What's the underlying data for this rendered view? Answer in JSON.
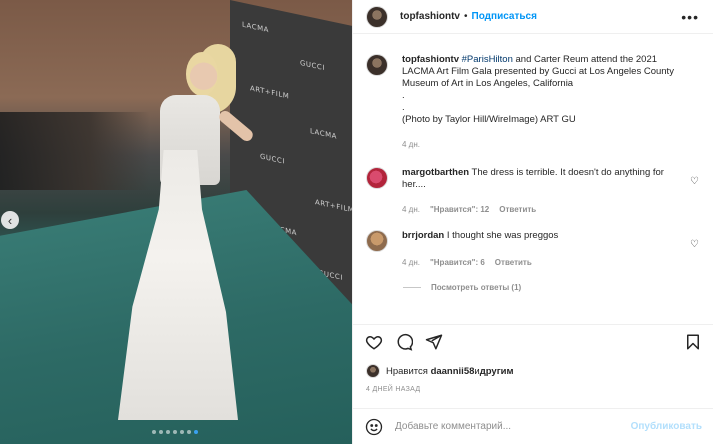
{
  "post": {
    "username": "topfashiontv",
    "follow_label": "Подписаться",
    "more_label": "•••",
    "caption_pre": " ",
    "hashtag": "#ParisHilton",
    "caption_text": " and Carter Reum attend the 2021 LACMA Art Film Gala presented by Gucci at Los Angeles County Museum of Art in Los Angeles, California",
    "caption_dot1": ".",
    "caption_dot2": ".",
    "caption_credit": "(Photo by Taylor Hill/WireImage) ART GU",
    "caption_time": "4 дн."
  },
  "photo": {
    "carousel_dots": 7,
    "active_dot": 6,
    "prev_icon": "chevron-left-icon",
    "backdrop_logos": [
      "LACMA",
      "GUCCI",
      "ART+FILM",
      "LACMA",
      "GUCCI",
      "ART+FILM",
      "LACMA",
      "GUCCI"
    ]
  },
  "comments": [
    {
      "username": "margotbarthen",
      "text": "The dress is terrible. It doesn't do anything for her....",
      "time": "4 дн.",
      "likes": "\"Нравится\": 12",
      "reply_label": "Ответить"
    },
    {
      "username": "brrjordan",
      "text": "I thought she was preggos",
      "time": "4 дн.",
      "likes": "\"Нравится\": 6",
      "reply_label": "Ответить"
    }
  ],
  "view_replies_label": "Посмотреть ответы (1)",
  "likes_line": {
    "prefix": "Нравится ",
    "user": "daannii58",
    "suffix": " и ",
    "others": "другим"
  },
  "time_ago": "4 ДНЕЙ НАЗАД",
  "composer": {
    "placeholder": "Добавьте комментарий...",
    "post_label": "Опубликовать"
  },
  "colors": {
    "accent": "#0095f6",
    "post_disabled": "#b2dffc",
    "muted": "#8e8e8e"
  }
}
